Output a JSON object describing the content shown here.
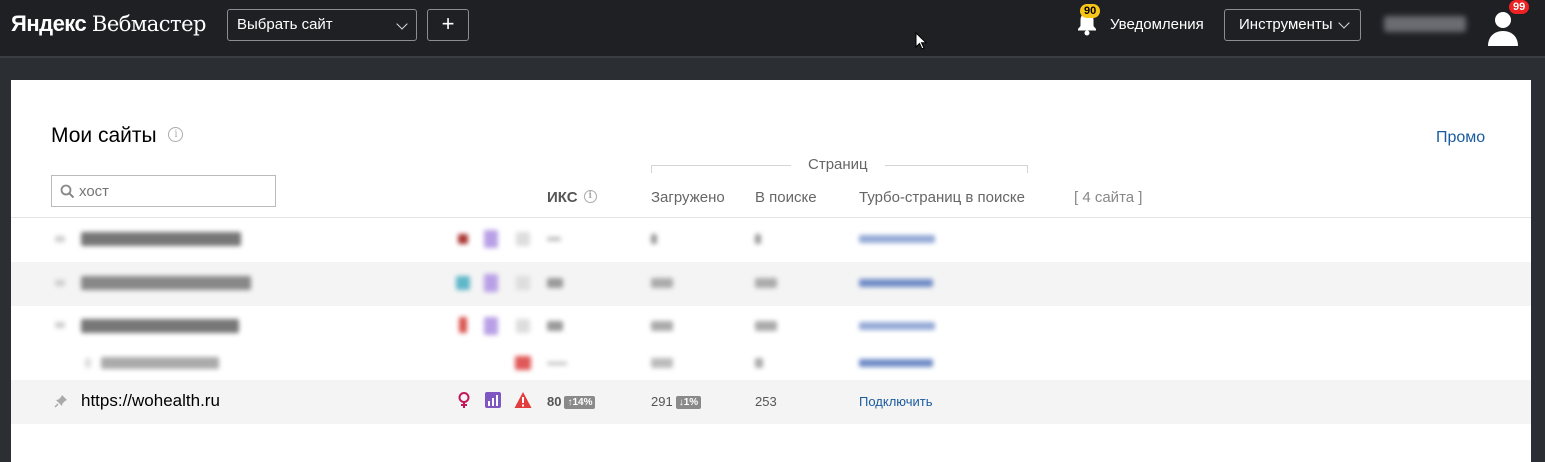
{
  "header": {
    "logo_brand": "Яндекс",
    "logo_product": "Вебмастер",
    "site_select_label": "Выбрать сайт",
    "add_label": "+",
    "notifications_badge": "90",
    "notifications_label": "Уведомления",
    "tools_label": "Инструменты",
    "avatar_badge": "99"
  },
  "main": {
    "title": "Мои сайты",
    "info_glyph": "i",
    "promo_link": "Промо",
    "search_placeholder": "хост",
    "pages_group_label": "Страниц",
    "columns": {
      "iks": "ИКС",
      "loaded": "Загружено",
      "in_search": "В поиске",
      "turbo": "Турбо-страниц в поиске",
      "count": "[ 4 сайта ]"
    },
    "site": {
      "host": "https://wohealth.ru",
      "iks": "80",
      "iks_change": "↑14%",
      "loaded": "291",
      "loaded_change": "↓1%",
      "in_search": "253",
      "turbo_action": "Подключить"
    }
  },
  "colors": {
    "header_bg": "#1e2024",
    "page_bg": "#2b2e33",
    "link": "#1a5b9f",
    "notification_badge": "#f7c619",
    "avatar_badge": "#e22222",
    "warning_icon": "#e23c3c",
    "female_icon": "#c2185b",
    "chart_icon": "#7e57c2"
  }
}
